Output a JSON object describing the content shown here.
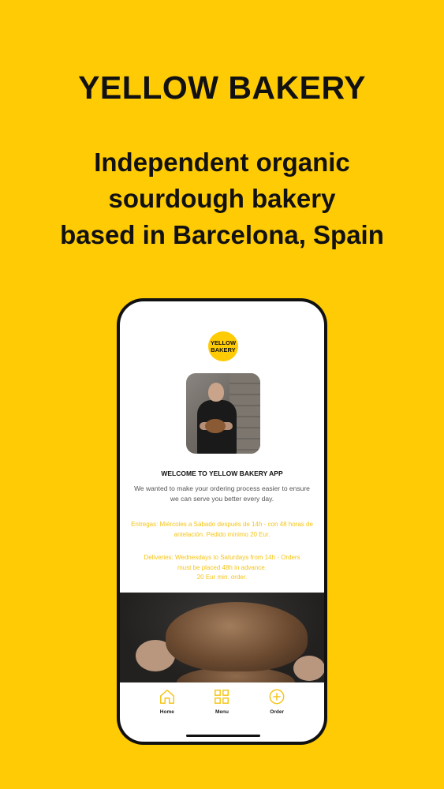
{
  "header": {
    "title": "YELLOW BAKERY",
    "tagline": [
      "Independent organic",
      "sourdough bakery",
      "based in Barcelona, Spain"
    ]
  },
  "app": {
    "logo": [
      "YELLOW",
      "BAKERY"
    ],
    "welcome_title": "WELCOME TO YELLOW BAKERY APP",
    "welcome_text": "We wanted to make your ordering process easier to ensure we can serve you better every day.",
    "info_es": "Entregas: Miércoles a Sábado después de 14h - con 48 horas de antelación. Pedido mínimo 20 Eur.",
    "info_en_lines": [
      "Deliveries: Wednesdays to Saturdays from 14h - Orders",
      "must be placed 48h in advance.",
      "20 Eur min. order."
    ],
    "tabs": [
      {
        "label": "Home",
        "icon": "home-icon"
      },
      {
        "label": "Menu",
        "icon": "grid-icon"
      },
      {
        "label": "Order",
        "icon": "plus-circle-icon"
      }
    ]
  },
  "colors": {
    "background": "#FFCB05",
    "accent_text": "#F5C518",
    "icon": "#F5C518"
  }
}
